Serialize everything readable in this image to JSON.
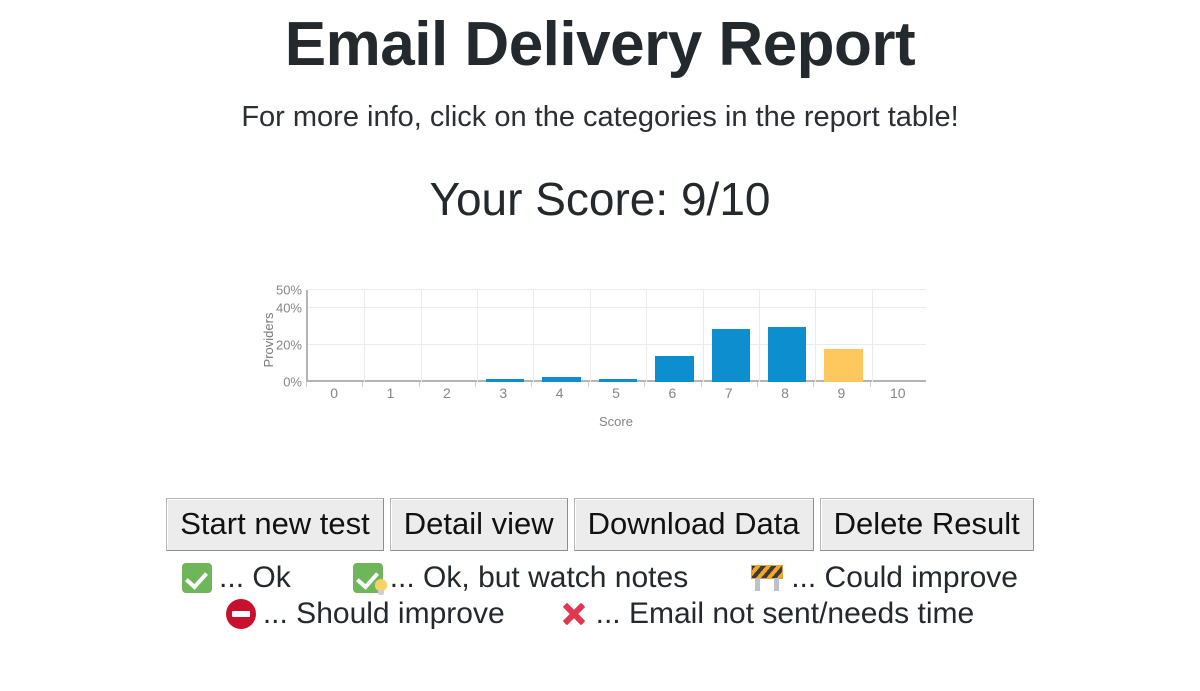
{
  "header": {
    "title": "Email Delivery Report",
    "subtitle": "For more info, click on the categories in the report table!",
    "score_heading": "Your Score: 9/10"
  },
  "colors": {
    "bar": "#0d8ecf",
    "bar_highlight": "#ffc85e",
    "ok_green": "#6fb55c",
    "should_improve_red": "#c8102e",
    "not_sent_red": "#e0364f"
  },
  "chart_data": {
    "type": "bar",
    "title": "",
    "xlabel": "Score",
    "ylabel": "Providers",
    "categories": [
      "0",
      "1",
      "2",
      "3",
      "4",
      "5",
      "6",
      "7",
      "8",
      "9",
      "10"
    ],
    "values": [
      0,
      0,
      0,
      1,
      3,
      1,
      14,
      29,
      30,
      18,
      0
    ],
    "highlight_index": 9,
    "ylim": [
      0,
      50
    ],
    "ytick_values": [
      0,
      20,
      40,
      50
    ],
    "ytick_labels": [
      "0%",
      "20%",
      "40%",
      "50%"
    ],
    "grid": true,
    "legend": false
  },
  "buttons": [
    {
      "label": "Start new test",
      "name": "start-new-test-button"
    },
    {
      "label": "Detail view",
      "name": "detail-view-button"
    },
    {
      "label": "Download Data",
      "name": "download-data-button"
    },
    {
      "label": "Delete Result",
      "name": "delete-result-button"
    }
  ],
  "legend": {
    "row1": [
      {
        "icon": "green-check-icon",
        "text": "... Ok"
      },
      {
        "icon": "green-check-bulb-icon",
        "text": "... Ok, but watch notes"
      },
      {
        "icon": "construction-barrier-icon",
        "text": "... Could improve"
      }
    ],
    "row2": [
      {
        "icon": "no-entry-icon",
        "text": "... Should improve"
      },
      {
        "icon": "red-cross-icon",
        "text": "... Email not sent/needs time"
      }
    ]
  }
}
